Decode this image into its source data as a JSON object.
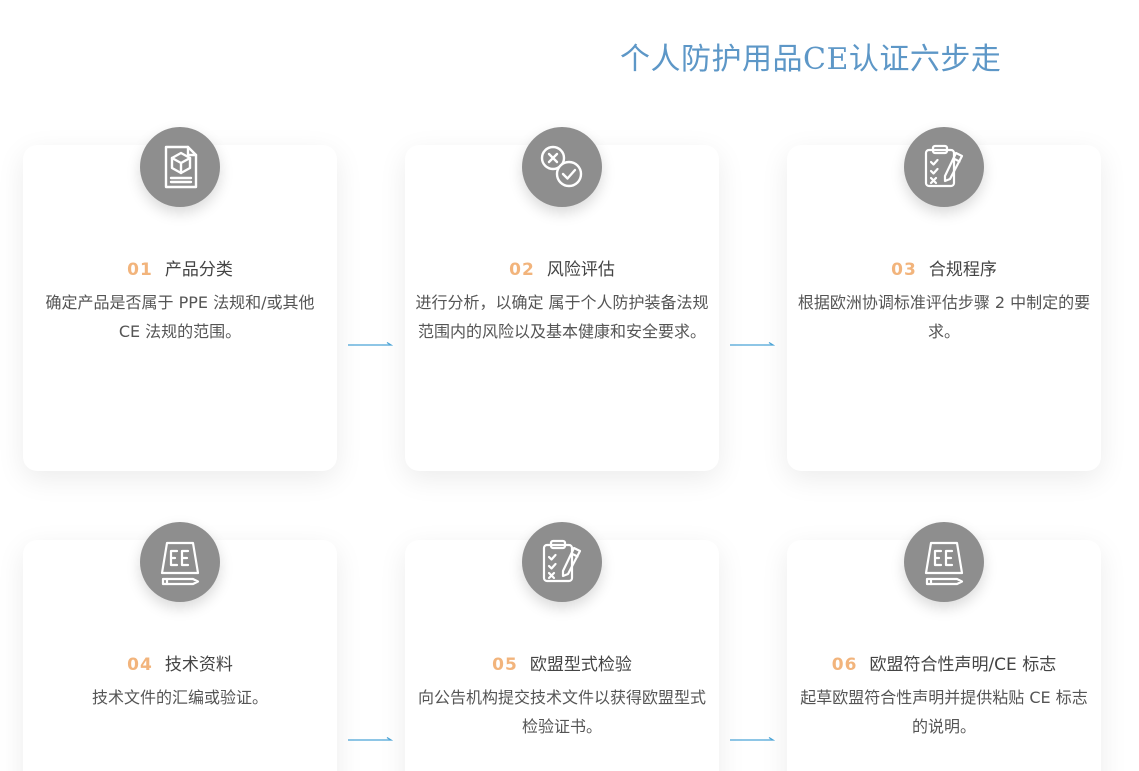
{
  "title": "个人防护用品CE认证六步走",
  "steps": [
    {
      "num": "01",
      "title": "产品分类",
      "desc": "确定产品是否属于 PPE 法规和/或其他 CE 法规的范围。",
      "icon": "product-box-document-icon"
    },
    {
      "num": "02",
      "title": "风险评估",
      "desc": "进行分析，以确定 属于个人防护装备法规范围内的风险以及基本健康和安全要求。",
      "icon": "cross-check-icon"
    },
    {
      "num": "03",
      "title": "合规程序",
      "desc": "根据欧洲协调标准评估步骤 2 中制定的要求。",
      "icon": "clipboard-pen-icon"
    },
    {
      "num": "04",
      "title": "技术资料",
      "desc": "技术文件的汇编或验证。",
      "icon": "ce-paper-pen-icon"
    },
    {
      "num": "05",
      "title": "欧盟型式检验",
      "desc": "向公告机构提交技术文件以获得欧盟型式检验证书。",
      "icon": "clipboard-pen-icon"
    },
    {
      "num": "06",
      "title": "欧盟符合性声明/CE 标志",
      "desc": "起草欧盟符合性声明并提供粘贴 CE 标志的说明。",
      "icon": "ce-paper-pen-icon"
    }
  ],
  "colors": {
    "title": "#5d97c7",
    "step_number": "#f2b47c",
    "icon_bg": "#8e8e8e",
    "connector": "#4aa3d6"
  }
}
